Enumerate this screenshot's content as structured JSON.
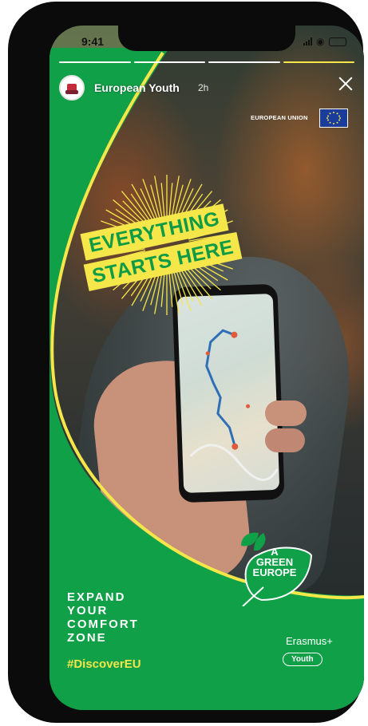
{
  "status_bar": {
    "time": "9:41"
  },
  "story": {
    "account_name": "European Youth",
    "posted_ago": "2h",
    "progress_segments": 4,
    "current_segment": 4
  },
  "sponsor": {
    "label": "EUROPEAN UNION",
    "flag_icon": "eu-flag-icon"
  },
  "banner": {
    "line1": "EVERYTHING",
    "line2": "STARTS HERE"
  },
  "badge": {
    "line1": "A",
    "line2": "GREEN",
    "line3": "EUROPE"
  },
  "bottom": {
    "lines": [
      "EXPAND",
      "YOUR",
      "COMFORT",
      "ZONE"
    ],
    "hashtag": "#DiscoverEU",
    "brand": "Erasmus+",
    "brand_sub": "Youth"
  },
  "colors": {
    "green": "#10a048",
    "yellow": "#f5e64a",
    "phone_frame": "#0b0b0b"
  }
}
